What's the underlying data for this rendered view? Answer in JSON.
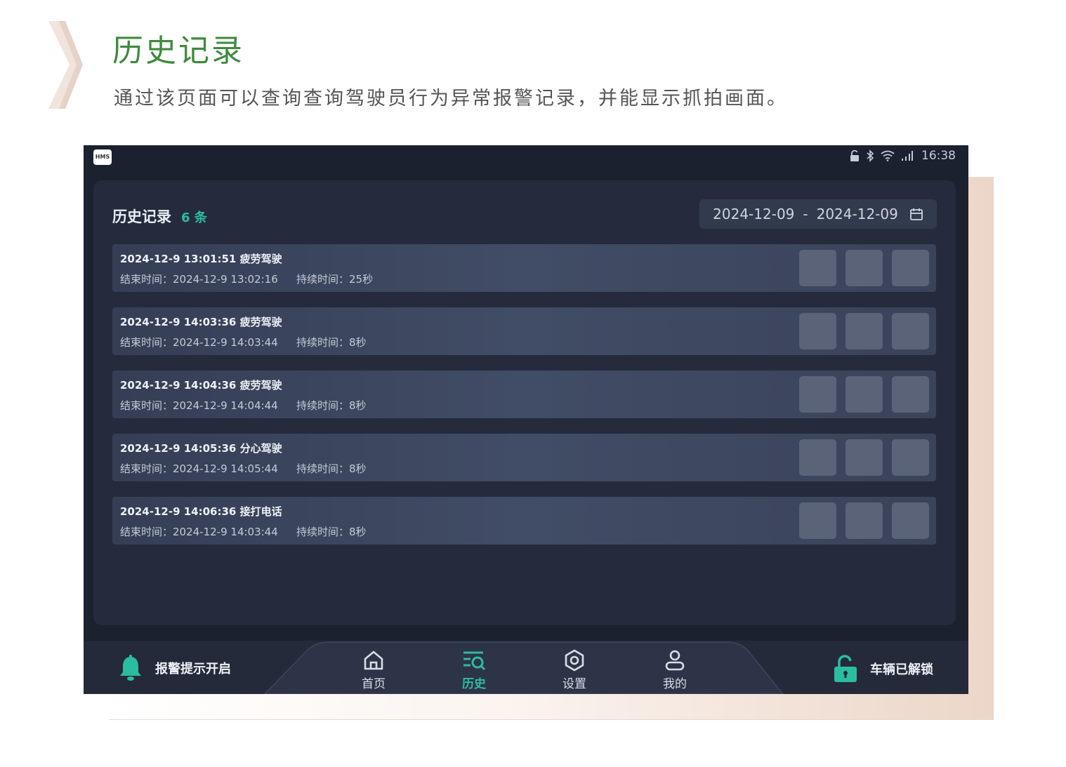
{
  "header": {
    "title": "历史记录",
    "description": "通过该页面可以查询查询驾驶员行为异常报警记录，并能显示抓拍画面。"
  },
  "status_bar": {
    "logo_text": "HMS",
    "time": "16:38"
  },
  "panel": {
    "title": "历史记录",
    "count": "6 条",
    "date_start": "2024-12-09",
    "date_separator": "-",
    "date_end": "2024-12-09"
  },
  "records": [
    {
      "start": "2024-12-9 13:01:51",
      "type": "疲劳驾驶",
      "end_text": "结束时间：2024-12-9 13:02:16",
      "duration_text": "持续时间：25秒"
    },
    {
      "start": "2024-12-9 14:03:36",
      "type": "疲劳驾驶",
      "end_text": "结束时间：2024-12-9 14:03:44",
      "duration_text": "持续时间：8秒"
    },
    {
      "start": "2024-12-9 14:04:36",
      "type": "疲劳驾驶",
      "end_text": "结束时间：2024-12-9 14:04:44",
      "duration_text": "持续时间：8秒"
    },
    {
      "start": "2024-12-9 14:05:36",
      "type": "分心驾驶",
      "end_text": "结束时间：2024-12-9 14:05:44",
      "duration_text": "持续时间：8秒"
    },
    {
      "start": "2024-12-9 14:06:36",
      "type": "接打电话",
      "end_text": "结束时间：2024-12-9 14:03:44",
      "duration_text": "持续时间：8秒"
    }
  ],
  "nav": {
    "alarm_label": "报警提示开启",
    "items": [
      {
        "label": "首页",
        "icon": "home-icon"
      },
      {
        "label": "历史",
        "icon": "history-icon",
        "active": true
      },
      {
        "label": "设置",
        "icon": "settings-icon"
      },
      {
        "label": "我的",
        "icon": "user-icon"
      }
    ],
    "lock_label": "车辆已解锁"
  },
  "colors": {
    "accent": "#2bbda1",
    "title_green": "#3f8a3f",
    "device_bg": "#1c2130",
    "panel_bg": "#252b3c"
  }
}
